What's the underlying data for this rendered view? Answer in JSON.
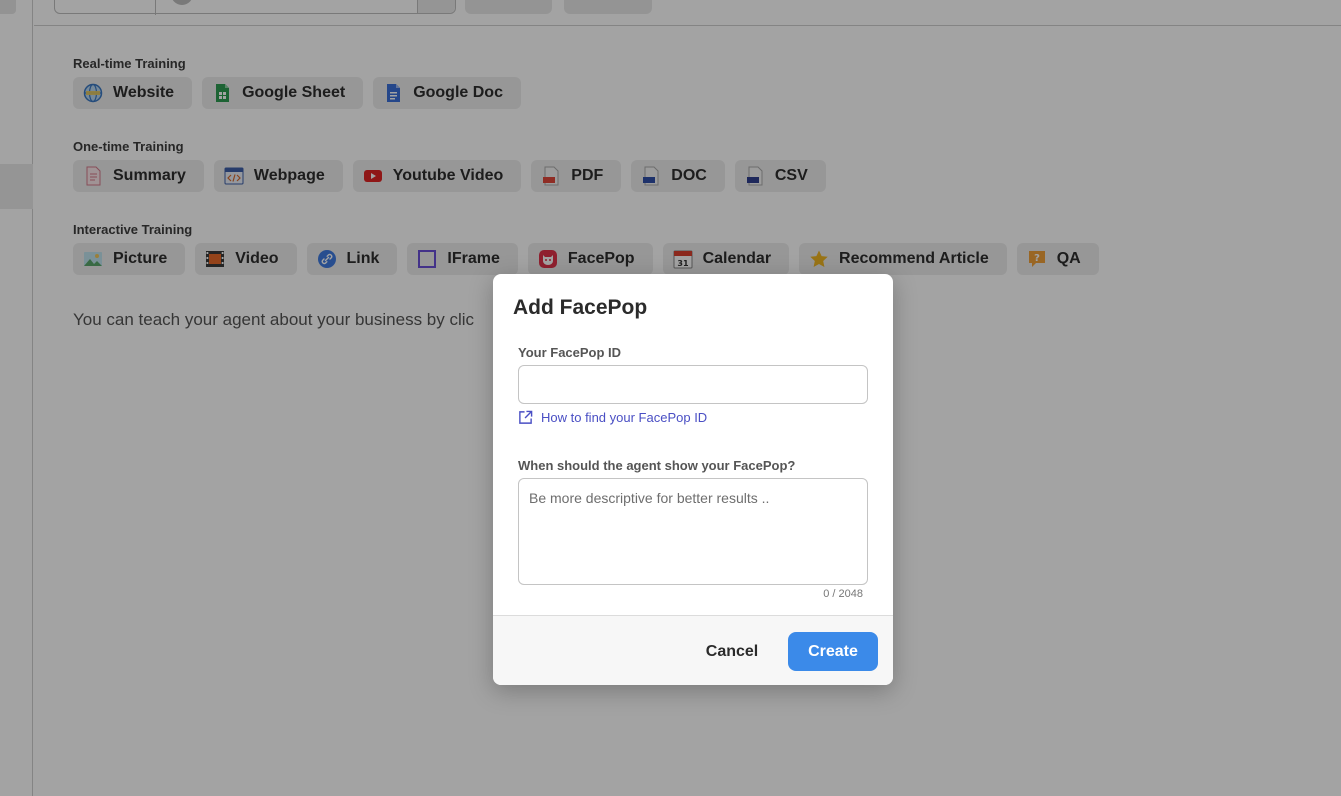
{
  "sections": {
    "realtime": {
      "title": "Real-time Training",
      "items": [
        {
          "label": "Website",
          "icon": "globe-icon"
        },
        {
          "label": "Google Sheet",
          "icon": "google-sheet-icon"
        },
        {
          "label": "Google Doc",
          "icon": "google-doc-icon"
        }
      ]
    },
    "onetime": {
      "title": "One-time Training",
      "items": [
        {
          "label": "Summary",
          "icon": "summary-doc-icon"
        },
        {
          "label": "Webpage",
          "icon": "webpage-code-icon"
        },
        {
          "label": "Youtube Video",
          "icon": "youtube-icon"
        },
        {
          "label": "PDF",
          "icon": "pdf-file-icon"
        },
        {
          "label": "DOC",
          "icon": "doc-file-icon"
        },
        {
          "label": "CSV",
          "icon": "csv-file-icon"
        }
      ]
    },
    "interactive": {
      "title": "Interactive Training",
      "items": [
        {
          "label": "Picture",
          "icon": "picture-icon"
        },
        {
          "label": "Video",
          "icon": "film-icon"
        },
        {
          "label": "Link",
          "icon": "link-icon"
        },
        {
          "label": "IFrame",
          "icon": "iframe-icon"
        },
        {
          "label": "FacePop",
          "icon": "facepop-icon"
        },
        {
          "label": "Calendar",
          "icon": "calendar-icon"
        },
        {
          "label": "Recommend Article",
          "icon": "star-icon"
        },
        {
          "label": "QA",
          "icon": "qa-icon"
        }
      ]
    }
  },
  "help_text": "You can teach your agent about your business by clic",
  "modal": {
    "title": "Add FacePop",
    "id_label": "Your FacePop ID",
    "id_value": "",
    "help_link": "How to find your FacePop ID",
    "when_label": "When should the agent show your FacePop?",
    "when_placeholder": "Be more descriptive for better results ..",
    "char_count": "0 / 2048",
    "cancel_label": "Cancel",
    "create_label": "Create"
  },
  "colors": {
    "overlay": "rgba(0,0,0,0.36)",
    "primary": "#3b8ae9",
    "link": "#4a4fc4"
  }
}
